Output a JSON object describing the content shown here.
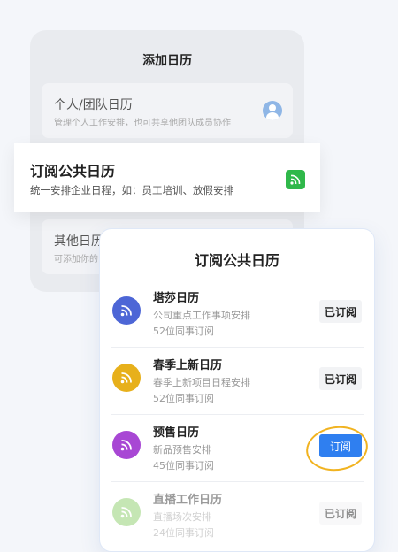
{
  "back_panel": {
    "title": "添加日历",
    "personal": {
      "title": "个人/团队日历",
      "subtitle": "管理个人工作安排，也可共享他团队成员协作"
    },
    "other": {
      "title": "其他日历",
      "subtitle": "可添加你的"
    }
  },
  "subscribe_card": {
    "title": "订阅公共日历",
    "subtitle": "统一安排企业日程，如：员工培训、放假安排",
    "icon": "rss-icon",
    "color": "#2fb84a"
  },
  "modal": {
    "title": "订阅公共日历",
    "rows": [
      {
        "name": "塔莎日历",
        "desc": "公司重点工作事项安排",
        "count": "52位同事订阅",
        "button": "已订阅",
        "color": "#4d66d6"
      },
      {
        "name": "春季上新日历",
        "desc": "春季上新项目日程安排",
        "count": "52位同事订阅",
        "button": "已订阅",
        "color": "#e7b01b"
      },
      {
        "name": "预售日历",
        "desc": "新品预售安排",
        "count": "45位同事订阅",
        "button": "订阅",
        "color": "#a847d4"
      },
      {
        "name": "直播工作日历",
        "desc": "直播场次安排",
        "count": "24位同事订阅",
        "button": "已订阅",
        "color": "#7fc85a"
      }
    ]
  }
}
